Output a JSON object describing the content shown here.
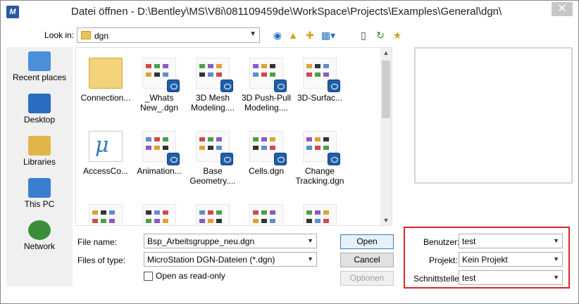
{
  "window": {
    "title": "Datei öffnen - D:\\Bentley\\MS\\V8i\\081109459de\\WorkSpace\\Projects\\Examples\\General\\dgn\\",
    "close_glyph": "✕"
  },
  "lookin": {
    "label": "Look in:",
    "value": "dgn"
  },
  "places": [
    {
      "label": "Recent places",
      "icon": "recent-places-icon",
      "color": "#4a90d9"
    },
    {
      "label": "Desktop",
      "icon": "desktop-icon",
      "color": "#2a6cc0"
    },
    {
      "label": "Libraries",
      "icon": "libraries-icon",
      "color": "#e0b64a"
    },
    {
      "label": "This PC",
      "icon": "this-pc-icon",
      "color": "#3b7dcf"
    },
    {
      "label": "Network",
      "icon": "network-icon",
      "color": "#3c8e3a"
    }
  ],
  "files": [
    {
      "line1": "Connection...",
      "line2": "",
      "kind": "folder"
    },
    {
      "line1": "_Whats",
      "line2": "New_.dgn",
      "kind": "dgn"
    },
    {
      "line1": "3D Mesh",
      "line2": "Modeling....",
      "kind": "dgn"
    },
    {
      "line1": "3D Push-Pull",
      "line2": "Modeling....",
      "kind": "dgn"
    },
    {
      "line1": "3D-Surfac...",
      "line2": "",
      "kind": "dgn"
    },
    {
      "line1": "AccessCo...",
      "line2": "",
      "kind": "exe"
    },
    {
      "line1": "Animation...",
      "line2": "",
      "kind": "dgn"
    },
    {
      "line1": "Base",
      "line2": "Geometry....",
      "kind": "dgn"
    },
    {
      "line1": "Cells.dgn",
      "line2": "",
      "kind": "dgn"
    },
    {
      "line1": "Change",
      "line2": "Tracking.dgn",
      "kind": "dgn"
    },
    {
      "line1": "",
      "line2": "",
      "kind": "dgn"
    },
    {
      "line1": "",
      "line2": "",
      "kind": "dgn"
    },
    {
      "line1": "",
      "line2": "",
      "kind": "dgn"
    },
    {
      "line1": "",
      "line2": "",
      "kind": "dgn"
    },
    {
      "line1": "",
      "line2": "",
      "kind": "dgn"
    }
  ],
  "form": {
    "filename_label": "File name:",
    "filename_value": "Bsp_Arbeitsgruppe_neu.dgn",
    "filetype_label": "Files of type:",
    "filetype_value": "MicroStation DGN-Dateien (*.dgn)",
    "readonly_label": "Open as read-only"
  },
  "buttons": {
    "open": "Open",
    "cancel": "Cancel",
    "options": "Optionen"
  },
  "custom": {
    "benutzer_label": "Benutzer:",
    "benutzer_value": "test",
    "projekt_label": "Projekt:",
    "projekt_value": "Kein Projekt",
    "schnittstelle_label": "Schnittstelle:",
    "schnittstelle_value": "test"
  },
  "colors": {
    "highlight_border": "#d9262a",
    "accent": "#1f5fa8"
  }
}
